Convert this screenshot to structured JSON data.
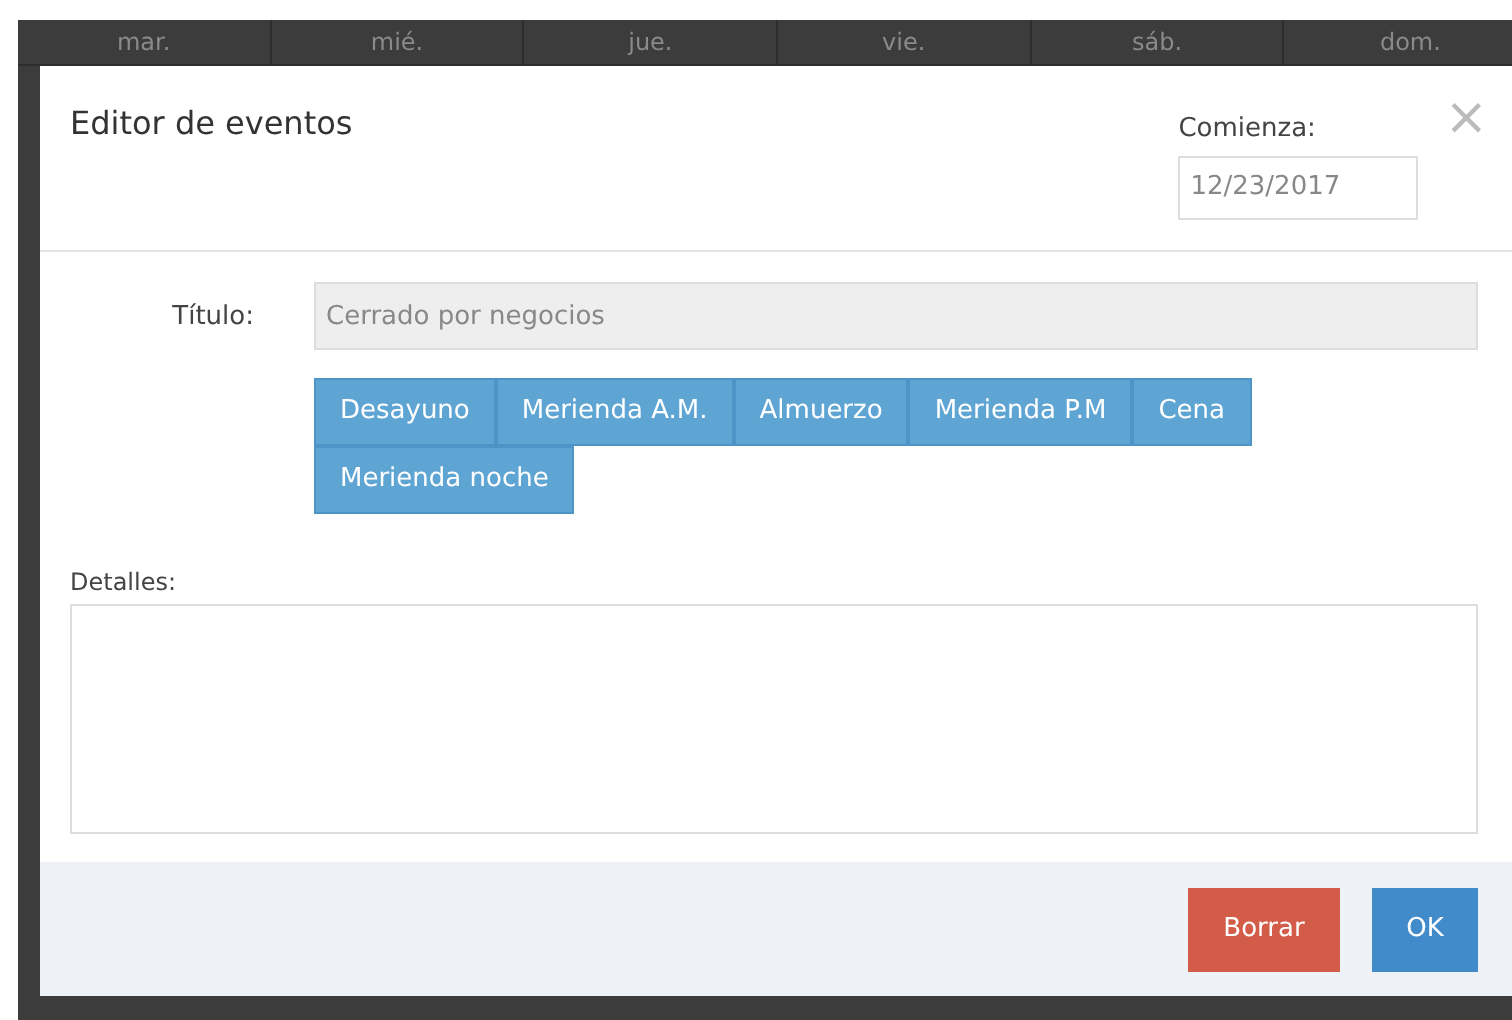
{
  "calendar": {
    "day_headers": [
      "mar.",
      "mié.",
      "jue.",
      "vie.",
      "sáb.",
      "dom."
    ]
  },
  "dialog": {
    "title": "Editor de eventos",
    "close": "×",
    "start": {
      "label": "Comienza:",
      "value": "12/23/2017"
    },
    "title_field": {
      "label": "Título:",
      "placeholder": "Cerrado por negocios"
    },
    "meal_buttons": [
      "Desayuno",
      "Merienda A.M.",
      "Almuerzo",
      "Merienda P.M",
      "Cena",
      "Merienda noche"
    ],
    "details": {
      "label": "Detalles:"
    },
    "buttons": [
      {
        "label": "Borrar",
        "kind": "danger"
      },
      {
        "label": "OK",
        "kind": "primary"
      }
    ]
  }
}
